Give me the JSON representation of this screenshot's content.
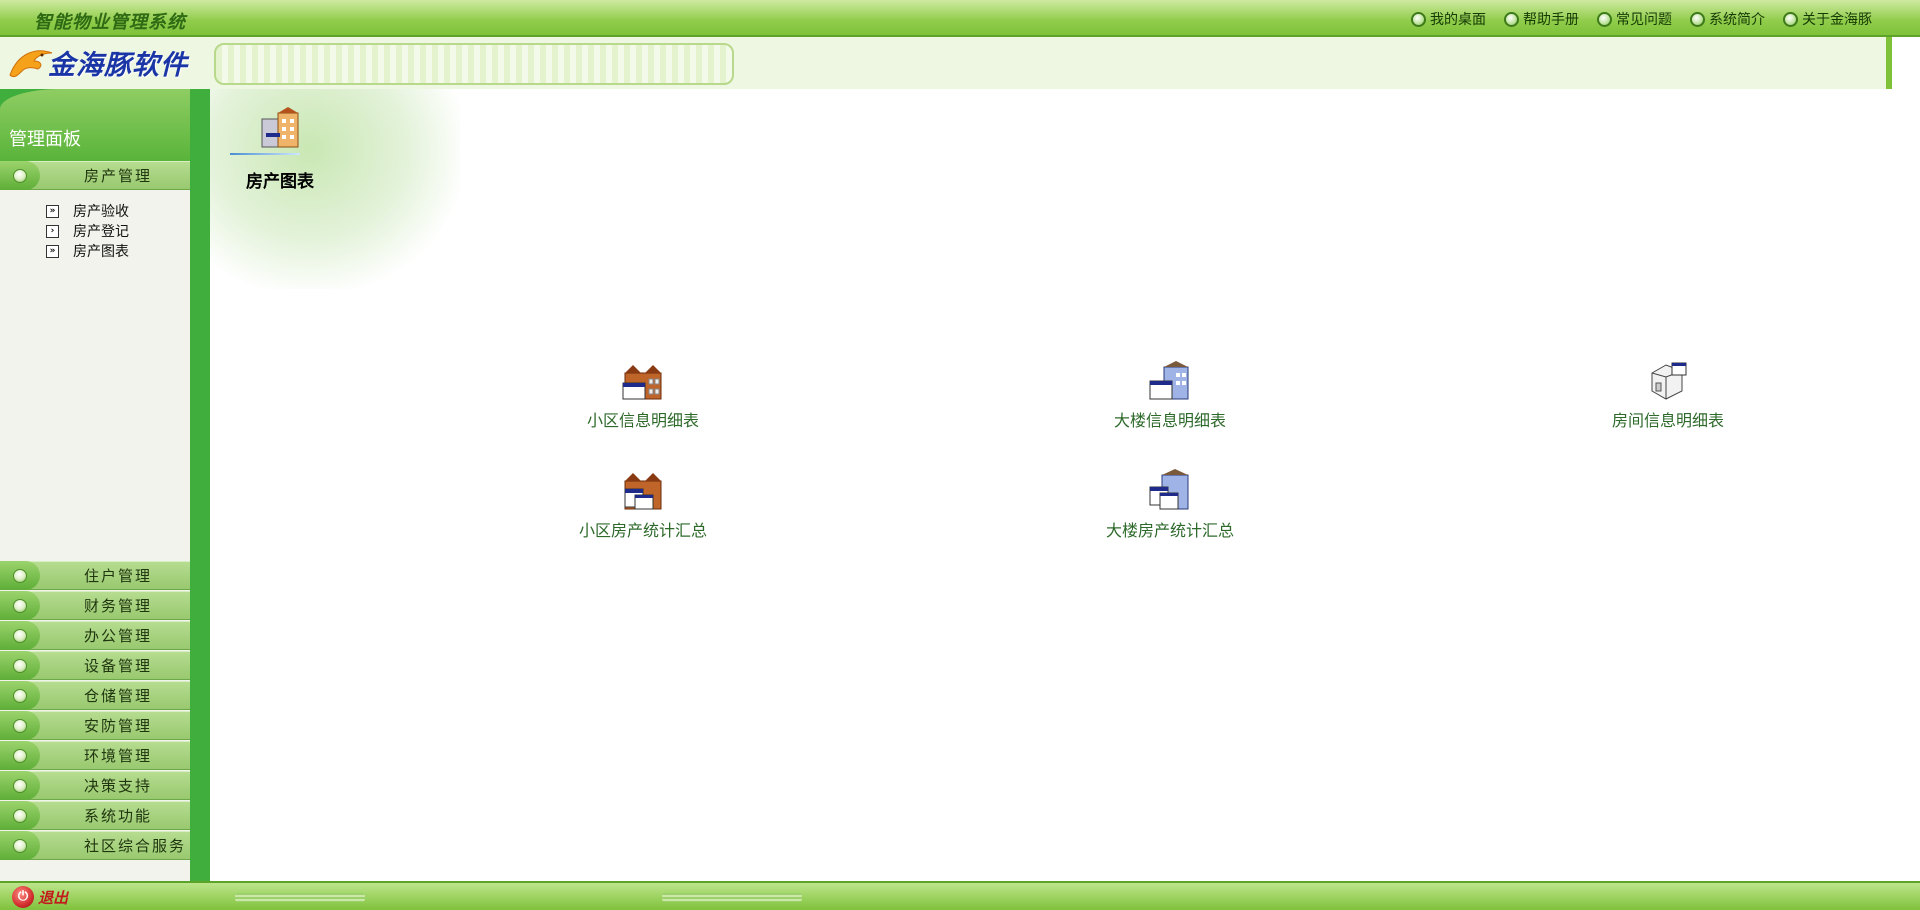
{
  "topbar": {
    "system_title": "智能物业管理系统",
    "nav": [
      {
        "label": "我的桌面",
        "icon": "ring-icon"
      },
      {
        "label": "帮助手册",
        "icon": "ring-icon"
      },
      {
        "label": "常见问题",
        "icon": "ring-icon"
      },
      {
        "label": "系统简介",
        "icon": "ring-icon"
      },
      {
        "label": "关于金海豚",
        "icon": "ring-icon"
      }
    ]
  },
  "header": {
    "logo_text": "金海豚软件"
  },
  "sidebar": {
    "panel_title": "管理面板",
    "active_group": "房产管理",
    "sub_items": [
      {
        "label": "房产验收",
        "icon": "double-arrow-icon"
      },
      {
        "label": "房产登记",
        "icon": "arrow-icon"
      },
      {
        "label": "房产图表",
        "icon": "double-arrow-icon"
      }
    ],
    "groups": [
      "住户管理",
      "财务管理",
      "办公管理",
      "设备管理",
      "仓储管理",
      "安防管理",
      "环境管理",
      "决策支持",
      "系统功能",
      "社区综合服务"
    ]
  },
  "footer": {
    "exit_label": "退出"
  },
  "main": {
    "page_title": "房产图表",
    "reports": [
      {
        "label": "小区信息明细表",
        "icon": "community-building-icon"
      },
      {
        "label": "大楼信息明细表",
        "icon": "tower-building-icon"
      },
      {
        "label": "房间信息明细表",
        "icon": "room-cube-icon"
      },
      {
        "label": "小区房产统计汇总",
        "icon": "community-stats-icon"
      },
      {
        "label": "大楼房产统计汇总",
        "icon": "tower-stats-icon"
      }
    ]
  },
  "colors": {
    "accent_green": "#7fc23a",
    "sidebar_green": "#3fae3c",
    "link_green": "#2d6a2a",
    "logo_blue": "#1a35a6"
  }
}
